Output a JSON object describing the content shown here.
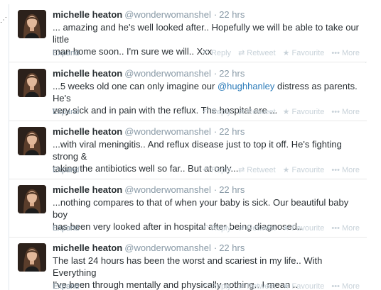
{
  "tweets": [
    {
      "fullname": "michelle heaton",
      "username": "@wonderwomanshel",
      "dot": "·",
      "time": "22 hrs",
      "text_parts": [
        {
          "type": "text",
          "value": "... amazing and he's well looked after.. Hopefully we will be able to take our little\nman home soon.. I'm sure we will.. Xxx"
        }
      ],
      "expand": "Expand"
    },
    {
      "fullname": "michelle heaton",
      "username": "@wonderwomanshel",
      "dot": "·",
      "time": "22 hrs",
      "text_parts": [
        {
          "type": "text",
          "value": "...5 weeks old one can only imagine our "
        },
        {
          "type": "mention",
          "value": "@hughhanley"
        },
        {
          "type": "text",
          "value": " distress as parents. He's\nvery sick and in pain with the reflux. The hospital are ..."
        }
      ],
      "expand": "Expand"
    },
    {
      "fullname": "michelle heaton",
      "username": "@wonderwomanshel",
      "dot": "·",
      "time": "22 hrs",
      "text_parts": [
        {
          "type": "text",
          "value": "...with viral meningitis.. And reflux disease just to top it off. He's fighting strong &\ntaking the antibiotics well so far.. But at only..."
        }
      ],
      "expand": "Expand"
    },
    {
      "fullname": "michelle heaton",
      "username": "@wonderwomanshel",
      "dot": "·",
      "time": "22 hrs",
      "text_parts": [
        {
          "type": "text",
          "value": "...nothing compares to that of when your baby is sick. Our beautiful baby boy\nhas been very looked after in hospital after being diagnosed.."
        }
      ],
      "expand": "Expand"
    },
    {
      "fullname": "michelle heaton",
      "username": "@wonderwomanshel",
      "dot": "·",
      "time": "22 hrs",
      "text_parts": [
        {
          "type": "text",
          "value": "The last 24 hours has been the worst and scariest in my life.. With Everything\nI've been through mentally and physically nothing.. I mean .."
        }
      ],
      "expand": "Expand"
    }
  ],
  "actions": {
    "reply": "Reply",
    "retweet": "Retweet",
    "favourite": "Favourite",
    "more": "More"
  },
  "icons": {
    "reply": "reply-arrow-icon",
    "retweet": "retweet-icon",
    "favourite": "star-icon",
    "more": "ellipsis-icon"
  },
  "colors": {
    "link": "#2b7bb9",
    "muted": "#8899a6",
    "action": "#c8d2d9"
  }
}
